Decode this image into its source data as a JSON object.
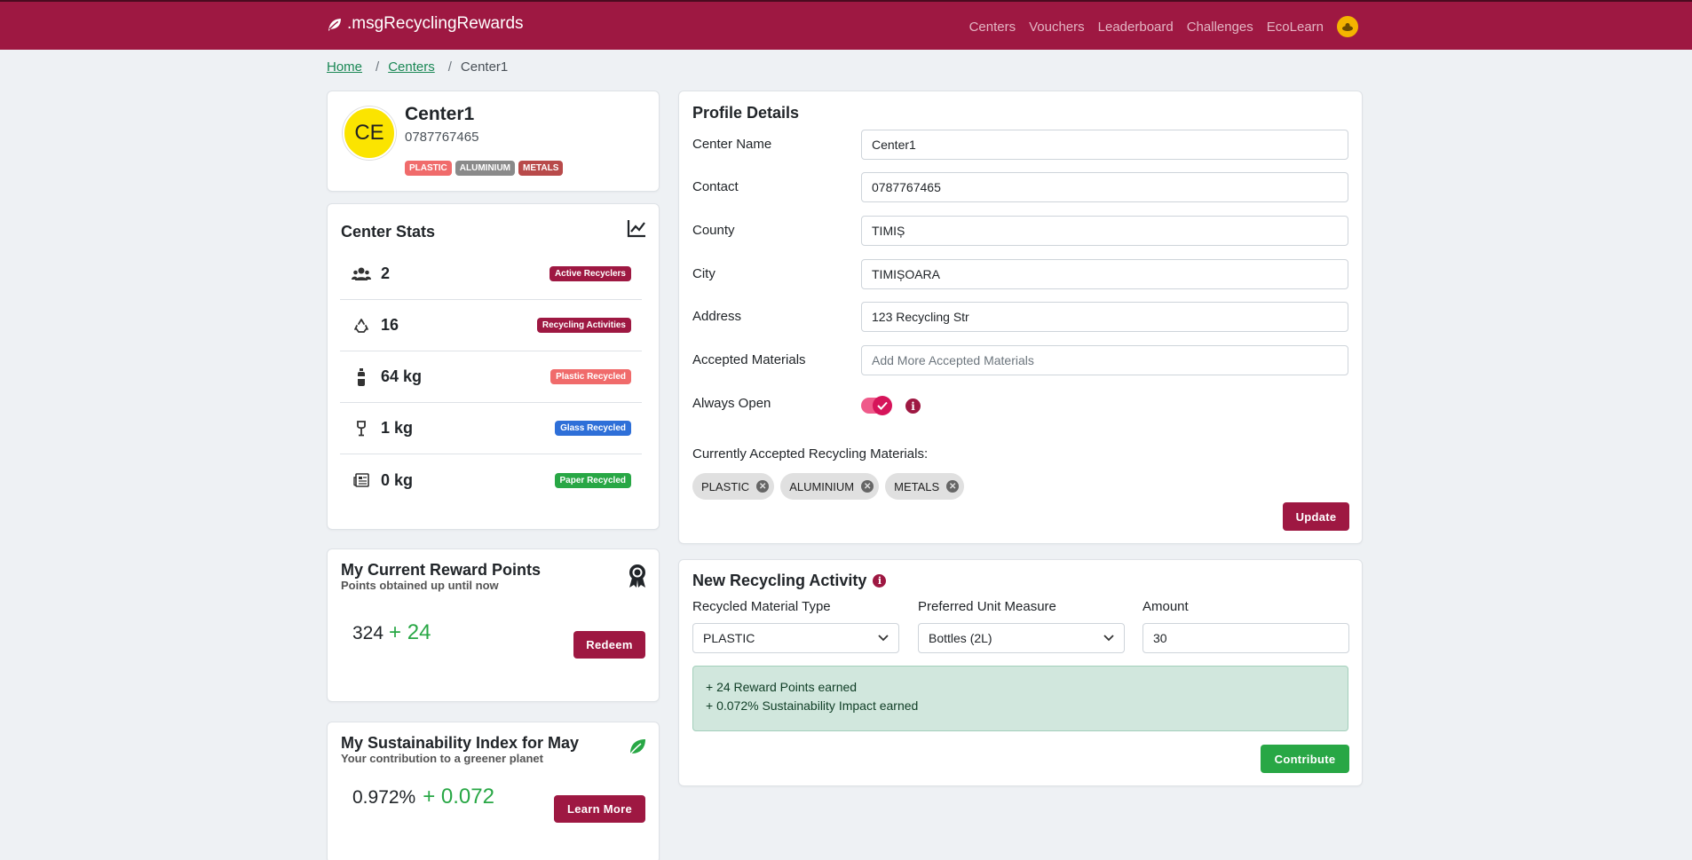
{
  "nav": {
    "brand": ".msgRecyclingRewards",
    "links": [
      "Centers",
      "Vouchers",
      "Leaderboard",
      "Challenges",
      "EcoLearn"
    ],
    "avatar_icon": "user-avatar-icon"
  },
  "breadcrumb": {
    "home": "Home",
    "centers": "Centers",
    "current": "Center1"
  },
  "profile_header": {
    "initials": "CE",
    "name": "Center1",
    "phone": "0787767465",
    "tags": [
      {
        "label": "PLASTIC",
        "color": "#f06b6b"
      },
      {
        "label": "ALUMINIUM",
        "color": "#8a8a8a"
      },
      {
        "label": "METALS",
        "color": "#b84a4a"
      }
    ]
  },
  "center_stats": {
    "title": "Center Stats",
    "rows": [
      {
        "icon": "users-icon",
        "value": "2",
        "badge": "Active Recyclers",
        "color": "#9e1842"
      },
      {
        "icon": "recycle-icon",
        "value": "16",
        "badge": "Recycling Activities",
        "color": "#9e1842"
      },
      {
        "icon": "bottle-icon",
        "value": "64 kg",
        "badge": "Plastic Recycled",
        "color": "#f06b6b"
      },
      {
        "icon": "wine-glass-icon",
        "value": "1 kg",
        "badge": "Glass Recycled",
        "color": "#2e6fd8"
      },
      {
        "icon": "newspaper-icon",
        "value": "0 kg",
        "badge": "Paper Recycled",
        "color": "#28a745"
      }
    ]
  },
  "reward_points": {
    "title": "My Current Reward Points",
    "subtitle": "Points obtained up until now",
    "value": "324",
    "plus": "+ 24",
    "button": "Redeem"
  },
  "sustainability": {
    "title": "My Sustainability Index for May",
    "subtitle": "Your contribution to a greener planet",
    "value": "0.972%",
    "plus": "+ 0.072",
    "button": "Learn More"
  },
  "profile_details": {
    "title": "Profile Details",
    "fields": {
      "center_name": {
        "label": "Center Name",
        "value": "Center1"
      },
      "contact": {
        "label": "Contact",
        "value": "0787767465"
      },
      "county": {
        "label": "County",
        "value": "TIMIȘ"
      },
      "city": {
        "label": "City",
        "value": "TIMIȘOARA"
      },
      "address": {
        "label": "Address",
        "value": "123 Recycling Str"
      },
      "accepted": {
        "label": "Accepted Materials",
        "placeholder": "Add More Accepted Materials"
      },
      "always_open": {
        "label": "Always Open"
      }
    },
    "current_label": "Currently Accepted Recycling Materials:",
    "chips": [
      "PLASTIC",
      "ALUMINIUM",
      "METALS"
    ],
    "update_button": "Update"
  },
  "new_activity": {
    "title": "New Recycling Activity",
    "material_label": "Recycled Material Type",
    "material_value": "PLASTIC",
    "unit_label": "Preferred Unit Measure",
    "unit_value": "Bottles (2L)",
    "amount_label": "Amount",
    "amount_value": "30",
    "alert_line1": "+ 24 Reward Points earned",
    "alert_line2": "+ 0.072% Sustainability Impact earned",
    "contribute_button": "Contribute"
  }
}
